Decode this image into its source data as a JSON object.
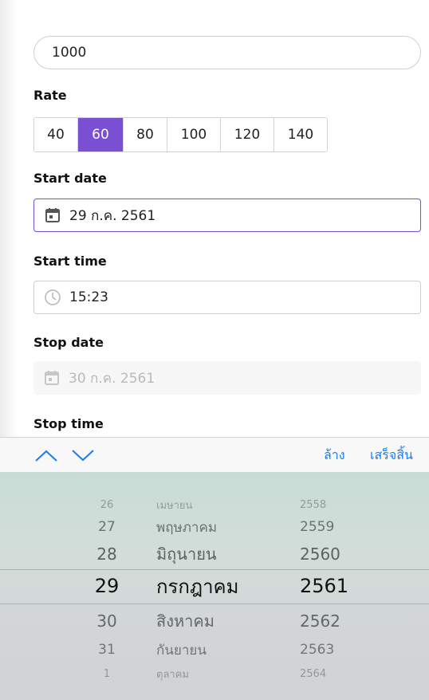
{
  "amount": {
    "value": "1000"
  },
  "rate": {
    "label": "Rate",
    "options": [
      "40",
      "60",
      "80",
      "100",
      "120",
      "140"
    ],
    "selected": "60"
  },
  "start_date": {
    "label": "Start date",
    "value": "29 ก.ค. 2561"
  },
  "start_time": {
    "label": "Start time",
    "value": "15:23"
  },
  "stop_date": {
    "label": "Stop date",
    "value": "30 ก.ค. 2561"
  },
  "stop_time": {
    "label": "Stop time"
  },
  "toolbar": {
    "clear_label": "ล้าง",
    "done_label": "เสร็จสิ้น"
  },
  "picker": {
    "rows": [
      {
        "day": "26",
        "month": "เมษายน",
        "year": "2558"
      },
      {
        "day": "27",
        "month": "พฤษภาคม",
        "year": "2559"
      },
      {
        "day": "28",
        "month": "มิถุนายน",
        "year": "2560"
      },
      {
        "day": "29",
        "month": "กรกฎาคม",
        "year": "2561"
      },
      {
        "day": "30",
        "month": "สิงหาคม",
        "year": "2562"
      },
      {
        "day": "31",
        "month": "กันยายน",
        "year": "2563"
      },
      {
        "day": "1",
        "month": "ตุลาคม",
        "year": "2564"
      }
    ],
    "selected_index": 3
  },
  "colors": {
    "accent": "#7b4fd4",
    "link": "#1a7cf2",
    "picker_bg": "#d2d8d7"
  }
}
